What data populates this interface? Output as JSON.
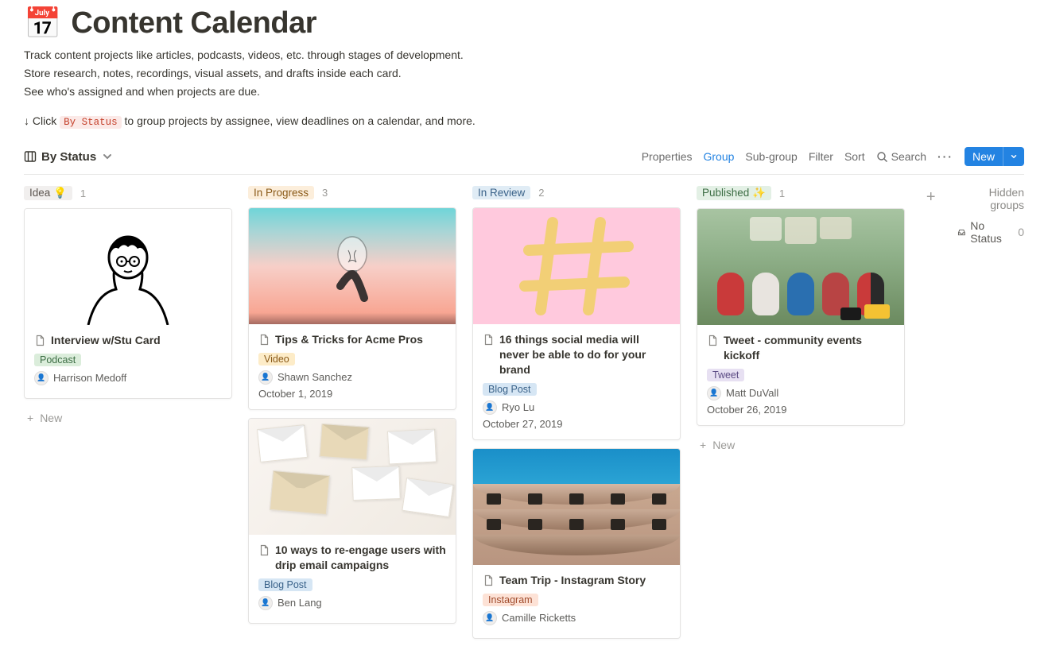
{
  "page": {
    "emoji": "📅",
    "title": "Content Calendar",
    "desc1": "Track content projects like articles, podcasts, videos, etc. through stages of development.",
    "desc2": "Store research, notes, recordings, visual assets, and drafts inside each card.",
    "desc3": "See who's assigned and when projects are due.",
    "hint_prefix": "↓ Click ",
    "hint_code": "By Status",
    "hint_suffix": " to group projects by assignee, view deadlines on a calendar, and more."
  },
  "viewbar": {
    "current_view": "By Status",
    "properties": "Properties",
    "group": "Group",
    "subgroup": "Sub-group",
    "filter": "Filter",
    "sort": "Sort",
    "search": "Search",
    "new": "New"
  },
  "columns": {
    "idea": {
      "label": "Idea 💡",
      "count": "1"
    },
    "progress": {
      "label": "In Progress",
      "count": "3"
    },
    "review": {
      "label": "In Review",
      "count": "2"
    },
    "published": {
      "label": "Published ✨",
      "count": "1"
    }
  },
  "cards": {
    "c1": {
      "title": "Interview w/Stu Card",
      "type": "Podcast",
      "assignee": "Harrison Medoff"
    },
    "c2": {
      "title": "Tips & Tricks for Acme Pros",
      "type": "Video",
      "assignee": "Shawn Sanchez",
      "date": "October 1, 2019"
    },
    "c3": {
      "title": "10 ways to re-engage users with drip email campaigns",
      "type": "Blog Post",
      "assignee": "Ben Lang"
    },
    "c4": {
      "title": "16 things social media will never be able to do for your brand",
      "type": "Blog Post",
      "assignee": "Ryo Lu",
      "date": "October 27, 2019"
    },
    "c5": {
      "title": "Team Trip - Instagram Story",
      "type": "Instagram",
      "assignee": "Camille Ricketts"
    },
    "c6": {
      "title": "Tweet - community events kickoff",
      "type": "Tweet",
      "assignee": "Matt DuVall",
      "date": "October 26, 2019"
    }
  },
  "misc": {
    "new_card": "New",
    "hidden_groups": "Hidden groups",
    "no_status": "No Status",
    "no_status_count": "0"
  }
}
